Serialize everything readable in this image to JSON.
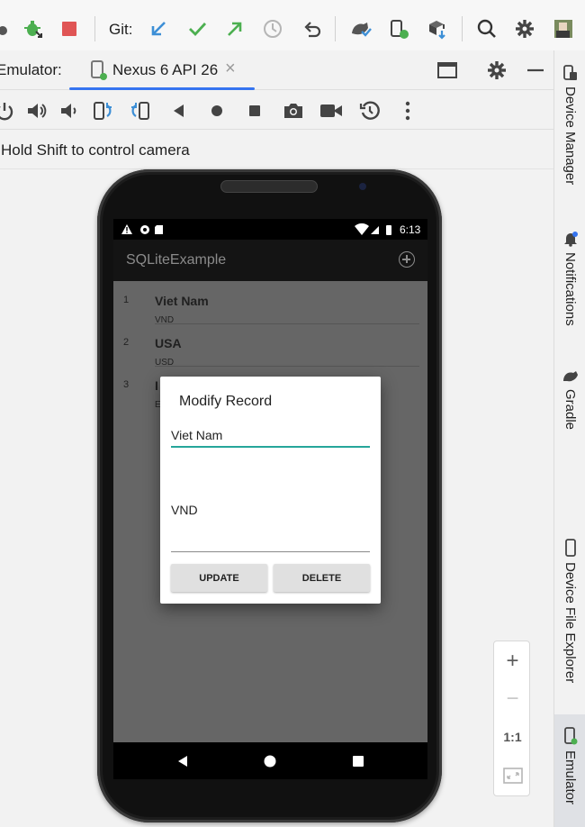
{
  "toolbar": {
    "git_label": "Git:",
    "icons": [
      "debug-attach-icon",
      "stop-icon",
      "git-update-icon",
      "git-commit-icon",
      "git-push-icon",
      "history-icon",
      "rollback-icon",
      "sync-gradle-icon",
      "device-manager-icon",
      "sdk-manager-icon",
      "search-icon",
      "settings-icon",
      "avatar"
    ]
  },
  "emulator_bar": {
    "label": "Emulator:",
    "tab_label": "Nexus 6 API 26",
    "close_glyph": "×"
  },
  "hint": "Hold Shift to control camera",
  "phone": {
    "time": "6:13",
    "app_title": "SQLiteExample",
    "records": [
      {
        "num": "1",
        "name": "Viet Nam",
        "currency": "VND"
      },
      {
        "num": "2",
        "name": "USA",
        "currency": "USD"
      },
      {
        "num": "3",
        "name": "I",
        "currency": "E"
      }
    ],
    "dialog": {
      "title": "Modify Record",
      "name_value": "Viet Nam",
      "currency_value": "VND",
      "update_label": "UPDATE",
      "delete_label": "DELETE"
    }
  },
  "zoom": {
    "plus": "+",
    "minus": "−",
    "one_to_one": "1:1"
  },
  "right_rail": {
    "device_manager": "Device Manager",
    "notifications": "Notifications",
    "gradle": "Gradle",
    "device_file_explorer": "Device File Explorer",
    "emulator": "Emulator"
  },
  "colors": {
    "accent": "#3574f0",
    "teal_field": "#26a69a",
    "stop_red": "#e05555",
    "git_blue": "#3d8fd6",
    "git_green": "#4caf50"
  }
}
